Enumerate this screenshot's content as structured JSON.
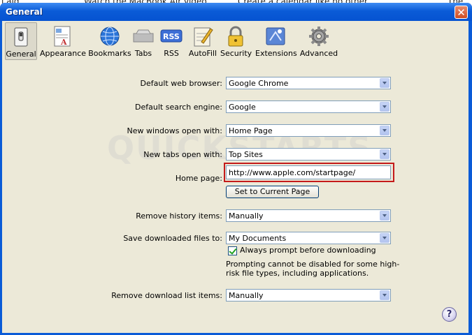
{
  "background_text": [
    "l aid.",
    "Watch the MacBook Air video.",
    "Create a calendar like no other.",
    "The"
  ],
  "window": {
    "title": "General",
    "close_glyph": "✕"
  },
  "toolbar": {
    "items": [
      {
        "label": "General",
        "icon": "general-switch-icon"
      },
      {
        "label": "Appearance",
        "icon": "appearance-icon"
      },
      {
        "label": "Bookmarks",
        "icon": "globe-icon"
      },
      {
        "label": "Tabs",
        "icon": "tabs-icon"
      },
      {
        "label": "RSS",
        "icon": "rss-icon"
      },
      {
        "label": "AutoFill",
        "icon": "autofill-pencil-icon"
      },
      {
        "label": "Security",
        "icon": "lock-icon"
      },
      {
        "label": "Extensions",
        "icon": "extensions-icon"
      },
      {
        "label": "Advanced",
        "icon": "gear-icon"
      }
    ],
    "rss_badge": "RSS"
  },
  "form": {
    "default_browser": {
      "label": "Default web browser:",
      "value": "Google Chrome"
    },
    "search_engine": {
      "label": "Default search engine:",
      "value": "Google"
    },
    "new_windows": {
      "label": "New windows open with:",
      "value": "Home Page"
    },
    "new_tabs": {
      "label": "New tabs open with:",
      "value": "Top Sites"
    },
    "home_page": {
      "label": "Home page:",
      "value": "http://www.apple.com/startpage/"
    },
    "set_current_button": "Set to Current Page",
    "remove_history": {
      "label": "Remove history items:",
      "value": "Manually"
    },
    "save_downloads": {
      "label": "Save downloaded files to:",
      "value": "My Documents"
    },
    "always_prompt": {
      "label": "Always prompt before downloading",
      "checked": true
    },
    "note": "Prompting cannot be disabled for some high-risk file types, including applications.",
    "remove_download_list": {
      "label": "Remove download list items:",
      "value": "Manually"
    }
  },
  "help_glyph": "?",
  "watermark": "QUICKSTARTS",
  "colors": {
    "titlebar": "#0a5bd7",
    "client": "#ece9d8",
    "highlight_box": "#c41a1a"
  }
}
